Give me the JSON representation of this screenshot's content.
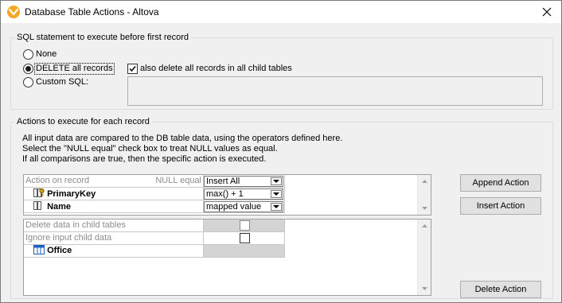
{
  "window": {
    "title": "Database Table Actions - Altova",
    "app_icon": "altova-mapforce-icon",
    "close_icon": "close-icon"
  },
  "sql_group": {
    "legend": "SQL statement to execute before first record",
    "options": [
      {
        "label": "None",
        "selected": false
      },
      {
        "label": "DELETE all records",
        "selected": true
      },
      {
        "label": "Custom SQL:",
        "selected": false
      }
    ],
    "also_delete_label": "also delete all records in all child tables",
    "also_delete_checked": true,
    "custom_sql_text": ""
  },
  "actions_group": {
    "legend": "Actions to execute for each record",
    "description": [
      "All input data are compared to the DB table data, using the operators defined here.",
      "Select the \"NULL equal\" check box to treat NULL values as equal.",
      "If all comparisons are true, then the specific action is executed."
    ],
    "top_grid": {
      "header": {
        "label": "Action on record",
        "null_equal": "NULL equal",
        "action": "Insert All"
      },
      "rows": [
        {
          "name": "PrimaryKey",
          "icon": "primary-key-field-icon",
          "value": "max() + 1"
        },
        {
          "name": "Name",
          "icon": "field-icon",
          "value": "mapped value"
        }
      ]
    },
    "bottom_grid": {
      "rows": [
        {
          "label": "Delete data in child tables",
          "checked": false
        },
        {
          "label": "Ignore input child data",
          "checked": false
        }
      ],
      "table": {
        "name": "Office",
        "icon": "table-icon"
      }
    },
    "buttons": {
      "append": "Append Action",
      "insert": "Insert Action",
      "delete": "Delete Action"
    }
  }
}
